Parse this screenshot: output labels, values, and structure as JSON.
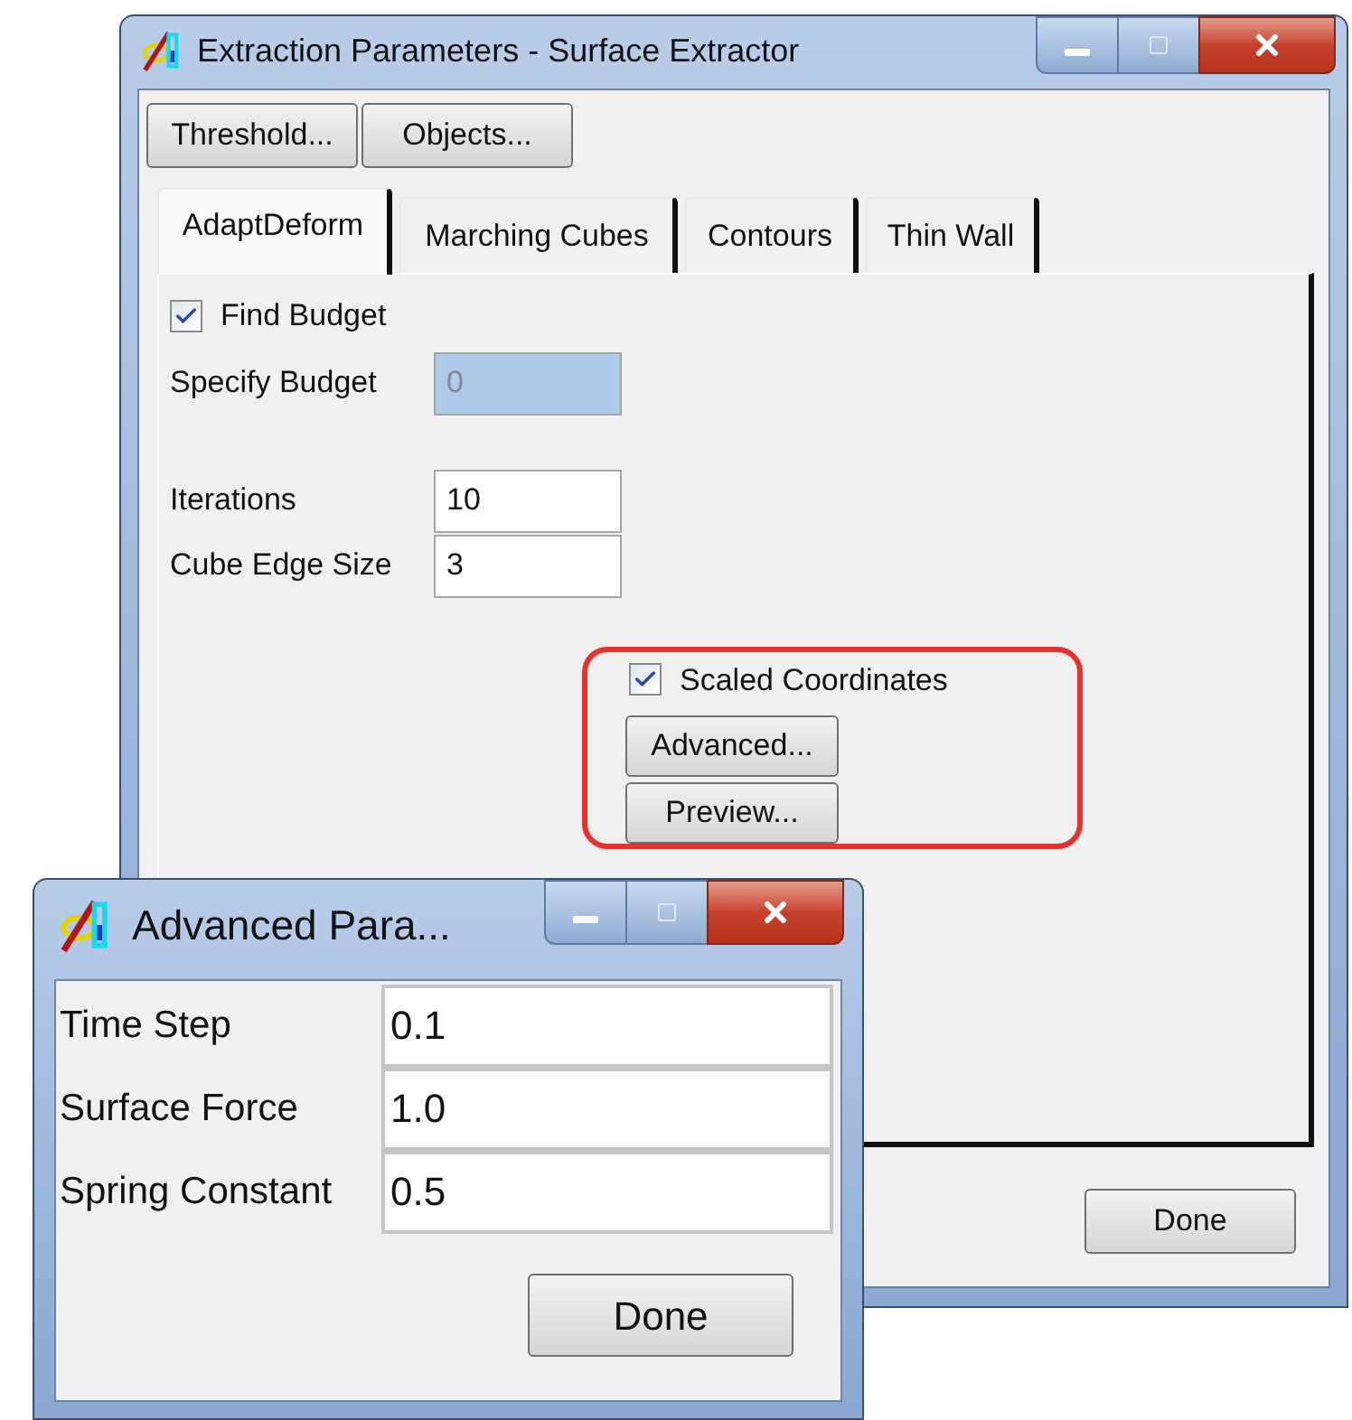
{
  "main_window": {
    "title": "Extraction Parameters - Surface Extractor",
    "toolbar_buttons": [
      "Threshold...",
      "Objects..."
    ],
    "tabs": [
      {
        "label": "AdaptDeform",
        "selected": true
      },
      {
        "label": "Marching Cubes",
        "selected": false
      },
      {
        "label": "Contours",
        "selected": false
      },
      {
        "label": "Thin Wall",
        "selected": false
      }
    ],
    "find_budget": {
      "label": "Find Budget",
      "checked": true
    },
    "specify_budget": {
      "label": "Specify Budget",
      "value": "0",
      "disabled": true
    },
    "fields": [
      {
        "label": "Iterations",
        "value": "10"
      },
      {
        "label": "Cube Edge Size",
        "value": "3"
      }
    ],
    "scaled_coordinates": {
      "label": "Scaled Coordinates",
      "checked": true
    },
    "panel_buttons": [
      "Advanced...",
      "Preview..."
    ],
    "done_button": "Done"
  },
  "advanced_window": {
    "title": "Advanced Para...",
    "fields": [
      {
        "label": "Time Step",
        "value": "0.1"
      },
      {
        "label": "Surface Force",
        "value": "1.0"
      },
      {
        "label": "Spring Constant",
        "value": "0.5"
      }
    ],
    "done_button": "Done"
  }
}
